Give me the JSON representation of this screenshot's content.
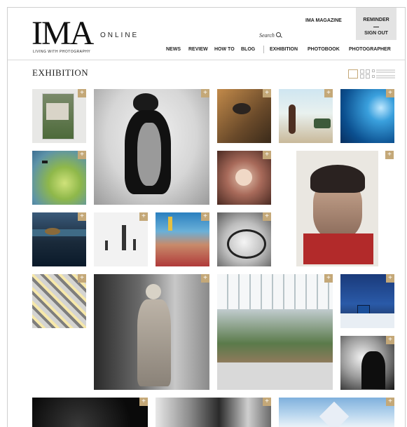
{
  "brand": {
    "name": "IMA",
    "online": "ONLINE",
    "tagline": "LIVING WITH PHOTOGRAPHY"
  },
  "header": {
    "magazine_link": "IMA MAGAZINE",
    "reminder": "REMINDER",
    "signout": "SIGN OUT",
    "search_label": "Search"
  },
  "nav": {
    "items": [
      "NEWS",
      "REVIEW",
      "HOW TO",
      "BLOG",
      "EXHIBITION",
      "PHOTOBOOK",
      "PHOTOGRAPHER"
    ]
  },
  "page": {
    "title": "EXHIBITION",
    "plus_label": "+"
  },
  "colors": {
    "accent": "#c4a878",
    "reminder_bg": "#e3e3e3"
  }
}
